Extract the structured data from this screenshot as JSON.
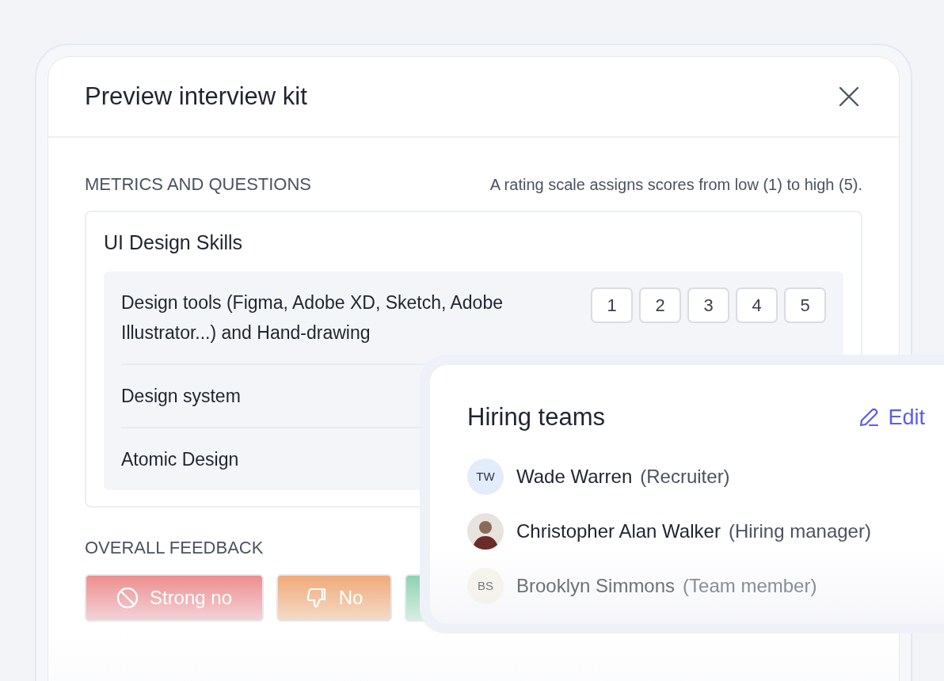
{
  "modal": {
    "title": "Preview interview kit"
  },
  "metrics": {
    "heading": "METRICS AND QUESTIONS",
    "note": "A rating scale assigns scores from low (1) to high (5).",
    "skill": {
      "title": "UI Design Skills",
      "questions": [
        {
          "text": "Design tools (Figma, Adobe XD, Sketch, Adobe Illustrator...) and Hand-drawing",
          "scale": [
            "1",
            "2",
            "3",
            "4",
            "5"
          ]
        },
        {
          "text": "Design system"
        },
        {
          "text": "Atomic Design"
        }
      ]
    }
  },
  "feedback": {
    "heading": "OVERALL FEEDBACK",
    "options": [
      {
        "kind": "strong_no",
        "label": "Strong no"
      },
      {
        "kind": "no",
        "label": "No"
      },
      {
        "kind": "yes"
      }
    ]
  },
  "hiring_teams": {
    "title": "Hiring teams",
    "edit": "Edit",
    "members": [
      {
        "kind": "initials",
        "initials": "TW",
        "name": "Wade Warren",
        "role": "(Recruiter)",
        "dimmed": false
      },
      {
        "kind": "photo",
        "name": "Christopher Alan Walker",
        "role": "(Hiring manager)",
        "dimmed": false
      },
      {
        "kind": "initials",
        "initials": "BS",
        "name": "Brooklyn Simmons",
        "role": "(Team member)",
        "dimmed": true
      }
    ]
  }
}
